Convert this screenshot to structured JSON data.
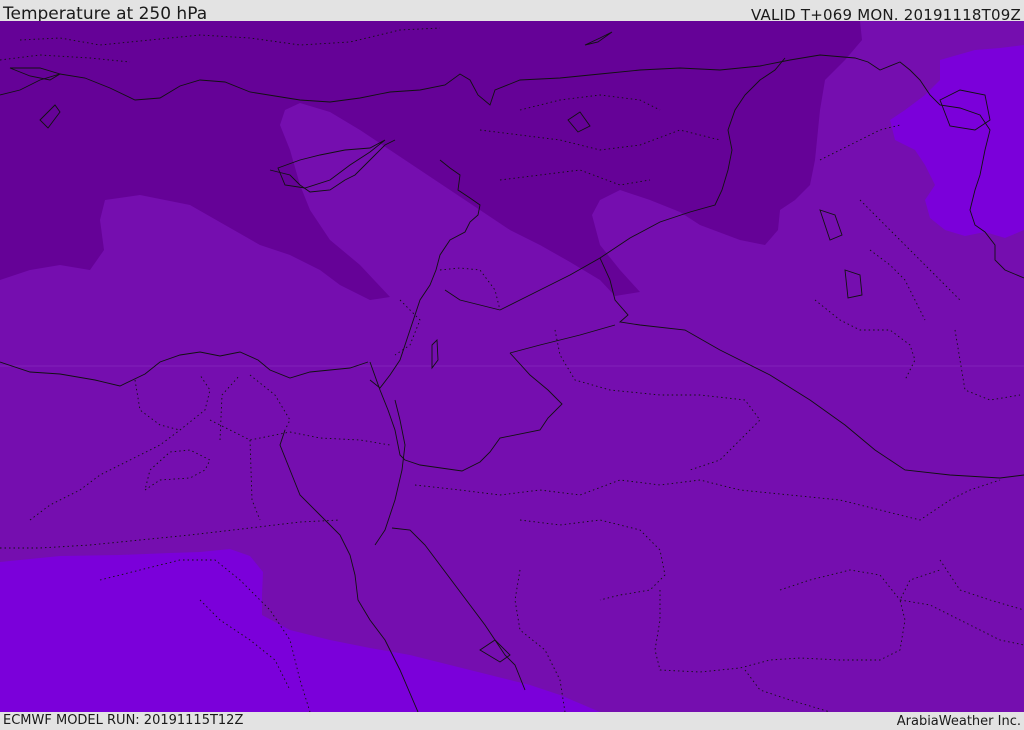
{
  "header": {
    "title": "Temperature at 250 hPa",
    "valid": "VALID T+069 MON. 20191118T09Z"
  },
  "footer": {
    "model_run": "ECMWF MODEL RUN: 20191115T12Z",
    "credit": "ArabiaWeather Inc."
  },
  "map": {
    "region": "Eastern Mediterranean and Middle East",
    "colors": {
      "coldest": "#650297",
      "cold": "#750eaf",
      "mild": "#7b00da",
      "mild_band": "#8405e6",
      "borders": "#111111"
    }
  }
}
